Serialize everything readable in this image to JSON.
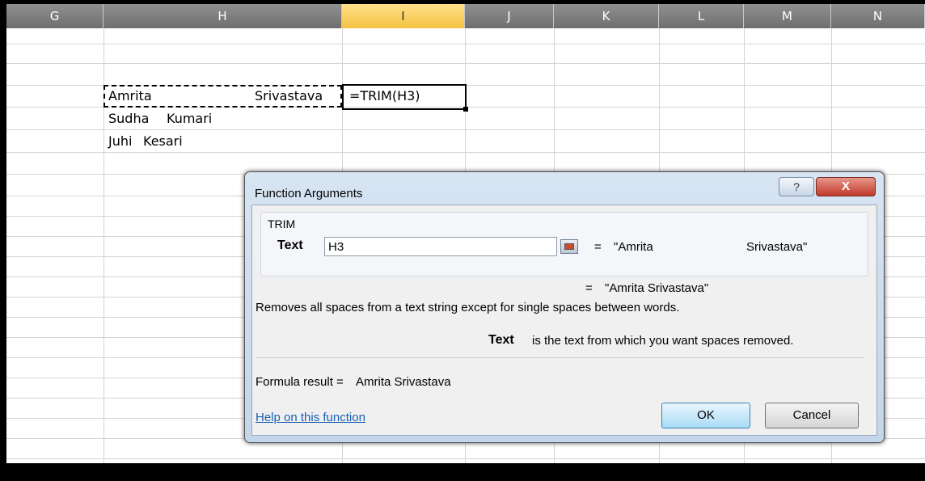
{
  "sheet": {
    "columns": [
      "G",
      "H",
      "I",
      "J",
      "K",
      "L",
      "M",
      "N"
    ],
    "active_column": "I",
    "cells": {
      "h3_first": "Amrita",
      "h3_last": "Srivastava",
      "i3_formula": "=TRIM(H3)",
      "h4_first": "Sudha",
      "h4_last": "Kumari",
      "h5_first": "Juhi",
      "h5_last": "Kesari"
    }
  },
  "dialog": {
    "title": "Function Arguments",
    "help_glyph": "?",
    "close_glyph": "X",
    "function_name": "TRIM",
    "arg_label": "Text",
    "arg_value": "H3",
    "arg_eq": "=",
    "arg_eval_part1": "\"Amrita",
    "arg_eval_part2": "Srivastava\"",
    "result_eq": "=",
    "result_eval": "\"Amrita Srivastava\"",
    "description": "Removes all spaces from a text string except for single spaces between words.",
    "arg_name_bold": "Text",
    "arg_description": "is the text from which you want spaces removed.",
    "formula_result_label": "Formula result =",
    "formula_result_value": "Amrita Srivastava",
    "help_link": "Help on this function",
    "ok_label": "OK",
    "cancel_label": "Cancel"
  },
  "colors": {
    "header_bg": "#7f7f7f",
    "active_header": "#f5c342",
    "close_button": "#c0392b",
    "link": "#1a5fb4"
  }
}
